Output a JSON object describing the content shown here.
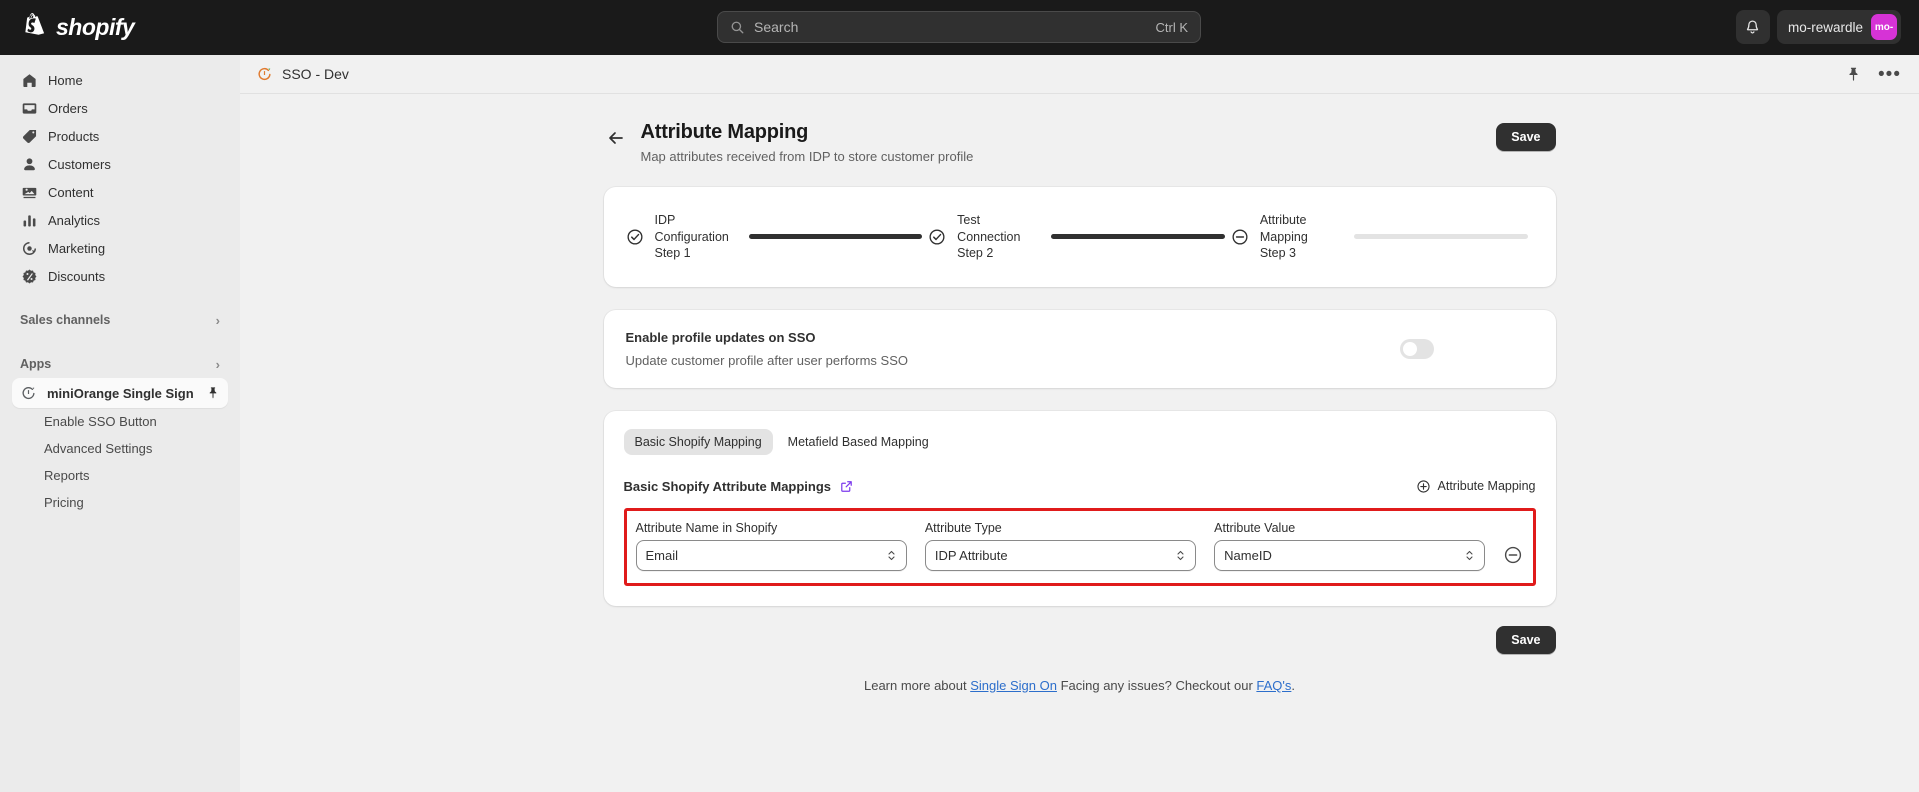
{
  "topbar": {
    "brand_name": "shopify",
    "search": {
      "placeholder": "Search",
      "shortcut": "Ctrl K"
    },
    "notifications_icon": "bell-icon",
    "store_name": "mo-rewardle",
    "store_avatar_text": "mo-",
    "avatar_color": "#d633d6"
  },
  "sidebar": {
    "nav": [
      {
        "label": "Home",
        "icon": "home-icon"
      },
      {
        "label": "Orders",
        "icon": "orders-icon"
      },
      {
        "label": "Products",
        "icon": "products-tag-icon"
      },
      {
        "label": "Customers",
        "icon": "customers-person-icon"
      },
      {
        "label": "Content",
        "icon": "content-image-icon"
      },
      {
        "label": "Analytics",
        "icon": "analytics-bars-icon"
      },
      {
        "label": "Marketing",
        "icon": "marketing-target-icon"
      },
      {
        "label": "Discounts",
        "icon": "discounts-badge-icon"
      }
    ],
    "sections": [
      {
        "label": "Sales channels",
        "chevron": "chevron-right-icon"
      },
      {
        "label": "Apps",
        "chevron": "chevron-right-icon"
      }
    ],
    "active_app": {
      "label": "miniOrange Single Sign",
      "icon": "miniorange-logo-icon",
      "pin": "pin-icon"
    },
    "app_subitems": [
      {
        "label": "Enable SSO Button"
      },
      {
        "label": "Advanced Settings"
      },
      {
        "label": "Reports"
      },
      {
        "label": "Pricing"
      }
    ]
  },
  "app_header": {
    "icon": "miniorange-logo-icon",
    "title": "SSO - Dev",
    "pin_icon": "pin-icon",
    "more_icon": "more-horizontal-icon",
    "more_glyph": "•••"
  },
  "page": {
    "back_icon": "back-arrow-icon",
    "title": "Attribute Mapping",
    "subtitle": "Map attributes received from IDP to store customer profile",
    "save_label": "Save"
  },
  "stepper": {
    "steps": [
      {
        "line1": "IDP",
        "line2": "Configuration",
        "line3": "Step 1",
        "icon": "check-circle-icon",
        "state": "done",
        "bar": "done"
      },
      {
        "line1": "Test",
        "line2": "Connection",
        "line3": "Step 2",
        "icon": "check-circle-icon",
        "state": "done",
        "bar": "done"
      },
      {
        "line1": "Attribute",
        "line2": "Mapping",
        "line3": "Step 3",
        "icon": "minus-circle-icon",
        "state": "current",
        "bar": "todo"
      }
    ]
  },
  "profile_updates": {
    "title": "Enable profile updates on SSO",
    "subtitle": "Update customer profile after user performs SSO",
    "toggle_state": "off"
  },
  "mapping": {
    "tabs": [
      {
        "label": "Basic Shopify Mapping",
        "active": true
      },
      {
        "label": "Metafield Based Mapping",
        "active": false
      }
    ],
    "section_title": "Basic Shopify Attribute Mappings",
    "external_link_icon": "external-link-icon",
    "add_button": {
      "label": "Attribute Mapping",
      "icon": "plus-circle-icon"
    },
    "columns": [
      "Attribute Name in Shopify",
      "Attribute Type",
      "Attribute Value"
    ],
    "rows": [
      {
        "attribute_name": "Email",
        "attribute_type": "IDP Attribute",
        "attribute_value": "NameID",
        "remove_icon": "minus-circle-icon",
        "highlighted": true,
        "highlight_color": "#e01b1b"
      }
    ],
    "save_label": "Save"
  },
  "footer": {
    "text_1": "Learn more about ",
    "link_1": "Single Sign On",
    "text_2": " Facing any issues? Checkout our ",
    "link_2": "FAQ's",
    "text_3": "."
  }
}
